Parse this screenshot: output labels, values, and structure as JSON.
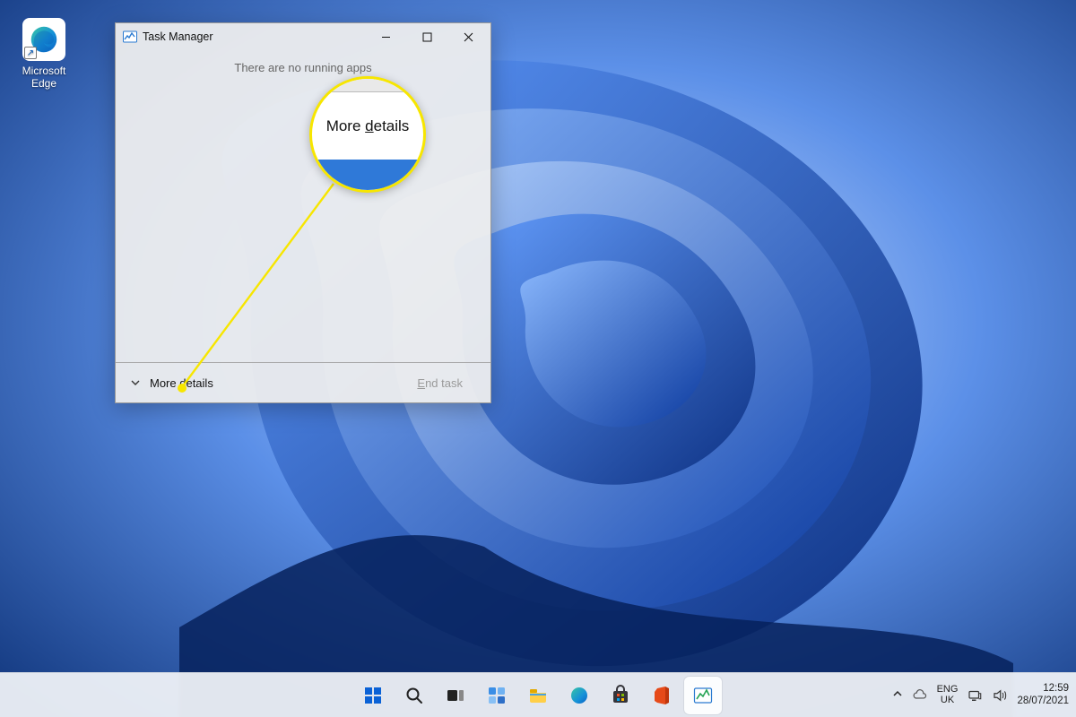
{
  "desktop": {
    "icons": [
      {
        "name": "Microsoft Edge",
        "label_line1": "Microsoft",
        "label_line2": "Edge"
      }
    ]
  },
  "task_manager": {
    "title": "Task Manager",
    "body_message": "There are no running apps",
    "more_details_prefix": "More ",
    "more_details_ud": "d",
    "more_details_suffix": "etails",
    "end_task_prefix": "",
    "end_task_ud": "E",
    "end_task_suffix": "nd task"
  },
  "callout": {
    "mag_prefix": "More ",
    "mag_ud": "d",
    "mag_suffix": "etails"
  },
  "taskbar": {
    "systray": {
      "lang_top": "ENG",
      "lang_bottom": "UK",
      "time": "12:59",
      "date": "28/07/2021"
    }
  }
}
